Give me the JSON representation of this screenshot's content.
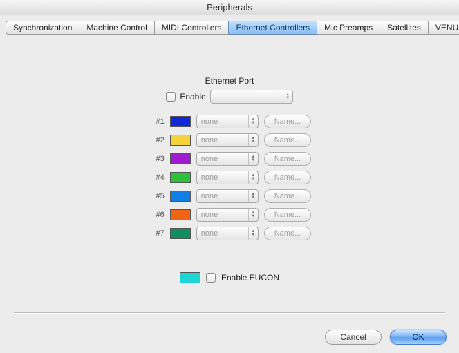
{
  "window": {
    "title": "Peripherals"
  },
  "tabs": {
    "items": [
      "Synchronization",
      "Machine Control",
      "MIDI Controllers",
      "Ethernet Controllers",
      "Mic Preamps",
      "Satellites",
      "VENUE"
    ],
    "selected_index": 3
  },
  "section": {
    "title": "Ethernet Port",
    "enable_label": "Enable",
    "port_value": ""
  },
  "rows": [
    {
      "num": "#1",
      "color": "#1128d6",
      "value": "none",
      "name_btn": "Name..."
    },
    {
      "num": "#2",
      "color": "#f4d33a",
      "value": "none",
      "name_btn": "Name..."
    },
    {
      "num": "#3",
      "color": "#a01bd0",
      "value": "none",
      "name_btn": "Name..."
    },
    {
      "num": "#4",
      "color": "#2ec23a",
      "value": "none",
      "name_btn": "Name..."
    },
    {
      "num": "#5",
      "color": "#0f7fe6",
      "value": "none",
      "name_btn": "Name..."
    },
    {
      "num": "#6",
      "color": "#f06515",
      "value": "none",
      "name_btn": "Name..."
    },
    {
      "num": "#7",
      "color": "#0f8f60",
      "value": "none",
      "name_btn": "Name..."
    }
  ],
  "eucon": {
    "color": "#1fd6d6",
    "label": "Enable EUCON"
  },
  "buttons": {
    "cancel": "Cancel",
    "ok": "OK"
  }
}
